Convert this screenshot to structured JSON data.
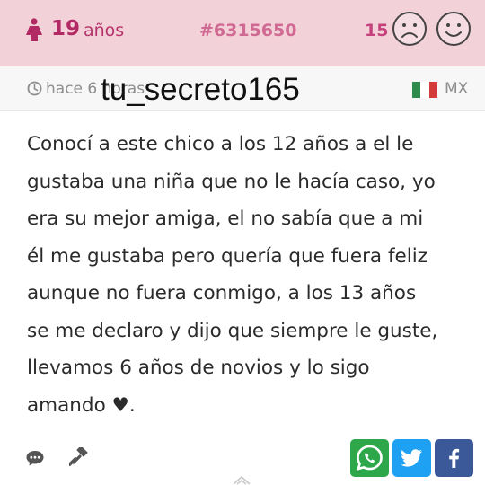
{
  "header": {
    "gender_icon": "female-icon",
    "age_number": "19",
    "age_unit": "años",
    "post_id": "#6315650",
    "vote_count": "15",
    "sad_icon": "sad-face-icon",
    "happy_icon": "happy-face-icon",
    "colors": {
      "background": "#f3d1d9",
      "accent": "#b22a63"
    }
  },
  "meta": {
    "clock_icon": "clock-icon",
    "time": "hace 6 horas",
    "username": "tu_secreto165",
    "flag_icon": "mexico-flag-icon",
    "country": "MX"
  },
  "post": {
    "lines": [
      "Conocí a este chico a los 12 años a el le",
      "gustaba una niña que no le hacía caso, yo",
      "era su mejor amiga, el no sabía que a mi",
      "él me gustaba pero quería que fuera feliz",
      "aunque no fuera conmigo, a los 13 años",
      "se me declaro y dijo que siempre le guste,",
      "llevamos 6 años de novios y lo sigo",
      "amando ♥."
    ]
  },
  "footer": {
    "comment_icon": "comment-icon",
    "report_icon": "hammer-icon",
    "share": [
      {
        "name": "whatsapp",
        "icon": "whatsapp-icon",
        "color": "#2ea74a"
      },
      {
        "name": "twitter",
        "icon": "twitter-icon",
        "color": "#1ea1f2"
      },
      {
        "name": "facebook",
        "icon": "facebook-icon",
        "color": "#3b5998"
      }
    ],
    "expand_icon": "chevron-up-icon"
  }
}
